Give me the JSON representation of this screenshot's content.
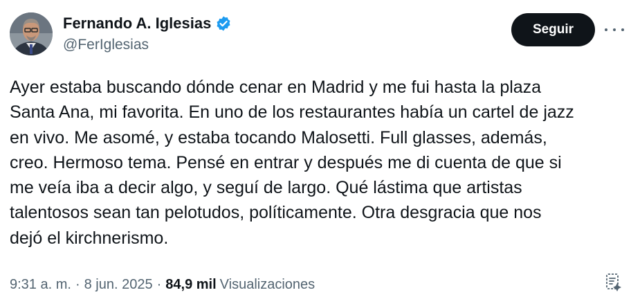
{
  "author": {
    "display_name": "Fernando A. Iglesias",
    "handle": "@FerIglesias",
    "verified": true,
    "avatar_icon": "profile-photo"
  },
  "actions": {
    "follow_label": "Seguir",
    "more_icon": "ellipsis-icon",
    "grok_icon": "grok-explain-icon"
  },
  "tweet": {
    "text_lines": [
      "Ayer estaba buscando dónde cenar en Madrid y me fui hasta la plaza",
      "Santa Ana, mi favorita. En uno de los restaurantes había un cartel de jazz",
      "en vivo. Me asomé, y estaba tocando Malosetti. Full glasses, además,",
      "creo. Hermoso tema. Pensé en entrar y después me di cuenta de que si",
      "me veía iba a decir algo, y seguí de largo. Qué lástima que artistas",
      "talentosos sean tan pelotudos, políticamente. Otra desgracia que nos",
      "dejó el kirchnerismo."
    ]
  },
  "meta": {
    "time": "9:31 a. m.",
    "separator": "·",
    "date": "8 jun. 2025",
    "views_count": "84,9 mil",
    "views_label": "Visualizaciones"
  },
  "colors": {
    "text_primary": "#0f1419",
    "text_secondary": "#536471",
    "verified_blue": "#1d9bf0",
    "button_bg": "#0f1419",
    "button_text": "#ffffff"
  }
}
